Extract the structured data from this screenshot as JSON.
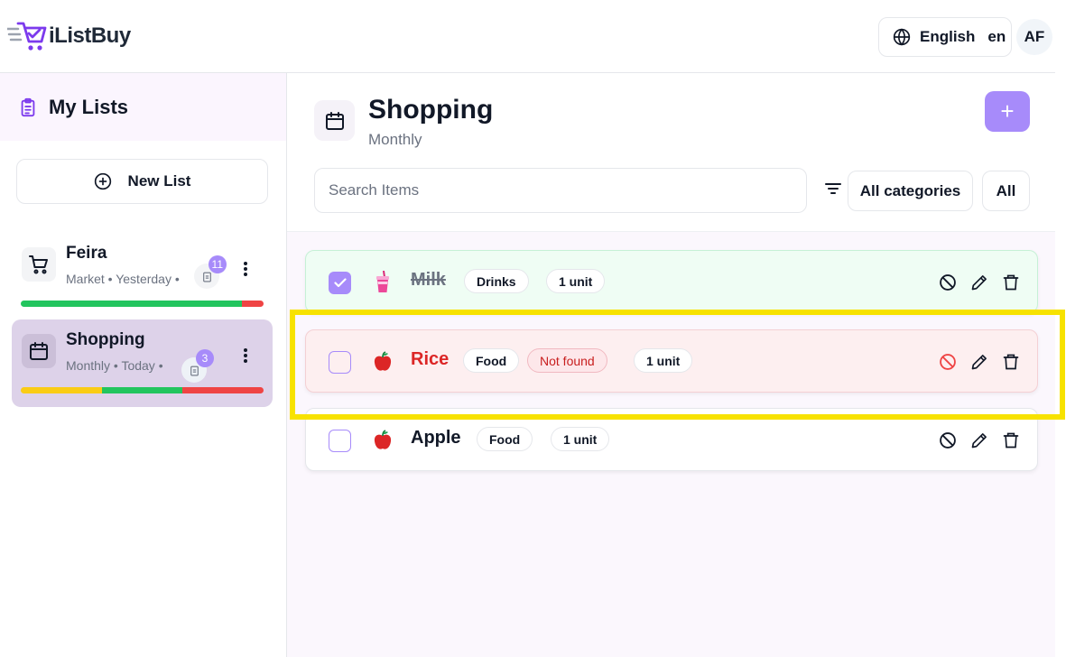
{
  "app": {
    "name": "iListBuy"
  },
  "header": {
    "language_name": "English",
    "language_code": "en",
    "avatar_initials": "AF"
  },
  "sidebar": {
    "title": "My Lists",
    "new_list_label": "New List",
    "lists": [
      {
        "name": "Feira",
        "type": "Market",
        "date": "Yesterday",
        "count": "11",
        "meta": "Market • Yesterday •",
        "icon": "shopping-cart-icon",
        "progress": [
          {
            "color": "#22c55e",
            "fraction": 0.91
          },
          {
            "color": "#ef4444",
            "fraction": 0.09
          }
        ]
      },
      {
        "name": "Shopping",
        "type": "Monthly",
        "date": "Today",
        "count": "3",
        "meta": "Monthly • Today •",
        "icon": "calendar-icon",
        "active": true,
        "progress": [
          {
            "color": "#facc15",
            "fraction": 0.333
          },
          {
            "color": "#22c55e",
            "fraction": 0.333
          },
          {
            "color": "#ef4444",
            "fraction": 0.334
          }
        ]
      }
    ]
  },
  "main": {
    "title": "Shopping",
    "subtitle": "Monthly",
    "add_label": "+",
    "search_placeholder": "Search Items",
    "category_filter": "All categories",
    "status_filter": "All",
    "items": [
      {
        "name": "Milk",
        "category": "Drinks",
        "quantity": "1 unit",
        "status": "done",
        "checked": true,
        "icon": "milk-drink-icon"
      },
      {
        "name": "Rice",
        "category": "Food",
        "status_label": "Not found",
        "quantity": "1 unit",
        "status": "not-found",
        "checked": false,
        "icon": "apple-icon"
      },
      {
        "name": "Apple",
        "category": "Food",
        "quantity": "1 unit",
        "status": "pending",
        "checked": false,
        "icon": "apple-icon"
      }
    ]
  },
  "colors": {
    "accent": "#a78bfa",
    "done_bg": "#effdf4",
    "notfound_bg": "#fdeff0",
    "highlight": "#f7e200"
  }
}
